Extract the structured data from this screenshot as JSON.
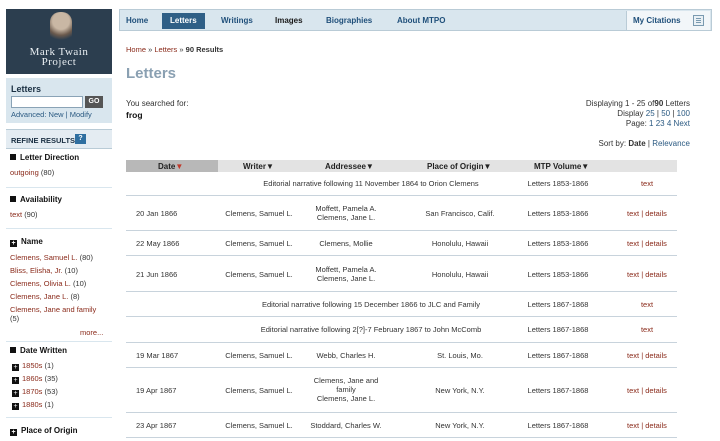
{
  "nav": {
    "items": [
      "Home",
      "Letters",
      "Writings",
      "Images",
      "Biographies",
      "About MTPO"
    ],
    "active": "Letters",
    "citations": "My Citations"
  },
  "logo": {
    "line1": "Mark Twain",
    "line2": "Project"
  },
  "search": {
    "label": "Letters",
    "value": "",
    "go": "GO",
    "advanced": "Advanced:",
    "new": "New",
    "sep": "|",
    "modify": "Modify"
  },
  "refine": {
    "label": "REFINE RESULTS",
    "help": "?"
  },
  "facets": {
    "direction": {
      "title": "Letter Direction",
      "items": [
        {
          "label": "outgoing",
          "count": "(80)"
        }
      ]
    },
    "availability": {
      "title": "Availability",
      "items": [
        {
          "label": "text",
          "count": "(90)"
        }
      ]
    },
    "name": {
      "title": "Name",
      "items": [
        {
          "label": "Clemens, Samuel L.",
          "count": "(80)"
        },
        {
          "label": "Bliss, Elisha, Jr.",
          "count": "(10)"
        },
        {
          "label": "Clemens, Olivia L.",
          "count": "(10)"
        },
        {
          "label": "Clemens, Jane L.",
          "count": "(8)"
        },
        {
          "label": "Clemens, Jane and family",
          "count": "(5)"
        }
      ],
      "more": "more..."
    },
    "date": {
      "title": "Date Written",
      "items": [
        {
          "label": "1850s",
          "count": "(1)"
        },
        {
          "label": "1860s",
          "count": "(35)"
        },
        {
          "label": "1870s",
          "count": "(53)"
        },
        {
          "label": "1880s",
          "count": "(1)"
        }
      ]
    },
    "origin": {
      "title": "Place of Origin"
    }
  },
  "breadcrumb": {
    "home": "Home",
    "letters": "Letters",
    "sep": "»",
    "results": "90 Results"
  },
  "title": "Letters",
  "searched": {
    "label": "You searched for:",
    "term": "frog"
  },
  "results": {
    "displaying": "Displaying 1 - 25 of",
    "total": "90",
    "unit": "Letters",
    "display_label": "Display",
    "sizes": [
      "25",
      "50",
      "100"
    ],
    "page_label": "Page:",
    "pages": [
      "1",
      "2",
      "3",
      "4"
    ],
    "next": "Next",
    "sort_label": "Sort by:",
    "sort_date": "Date",
    "sort_relevance": "Relevance"
  },
  "table": {
    "headers": [
      "Date",
      "Writer",
      "Addressee",
      "Place of Origin",
      "MTP Volume"
    ],
    "rows": [
      {
        "narrative": "Editorial narrative following 11 November 1864 to Orion Clemens",
        "volume": "Letters 1853-1866",
        "actions": "text"
      },
      {
        "date": "20 Jan 1866",
        "writer": "Clemens, Samuel L.",
        "addressee": "Moffett, Pamela A.\nClemens, Jane L.",
        "place": "San Francisco, Calif.",
        "volume": "Letters 1853-1866",
        "actions": "text | details"
      },
      {
        "date": "22 May 1866",
        "writer": "Clemens, Samuel L.",
        "addressee": "Clemens, Mollie",
        "place": "Honolulu, Hawaii",
        "volume": "Letters 1853-1866",
        "actions": "text | details"
      },
      {
        "date": "21 Jun 1866",
        "writer": "Clemens, Samuel L.",
        "addressee": "Moffett, Pamela A.\nClemens, Jane L.",
        "place": "Honolulu, Hawaii",
        "volume": "Letters 1853-1866",
        "actions": "text | details"
      },
      {
        "narrative": "Editorial narrative following 15 December 1866 to JLC and Family",
        "volume": "Letters 1867-1868",
        "actions": "text"
      },
      {
        "narrative": "Editorial narrative following 2[?]-7 February 1867 to John McComb",
        "volume": "Letters 1867-1868",
        "actions": "text"
      },
      {
        "date": "19 Mar 1867",
        "writer": "Clemens, Samuel L.",
        "addressee": "Webb, Charles H.",
        "place": "St. Louis, Mo.",
        "volume": "Letters 1867-1868",
        "actions": "text | details"
      },
      {
        "date": "19 Apr 1867",
        "writer": "Clemens, Samuel L.",
        "addressee": "Clemens, Jane and\nfamily\nClemens, Jane L.",
        "place": "New York, N.Y.",
        "volume": "Letters 1867-1868",
        "actions": "text | details"
      },
      {
        "date": "23 Apr 1867",
        "writer": "Clemens, Samuel L.",
        "addressee": "Stoddard, Charles W.",
        "place": "New York, N.Y.",
        "volume": "Letters 1867-1868",
        "actions": "text | details"
      }
    ]
  },
  "colors": {
    "nav_bg": "#d9e6ee",
    "active_tab": "#2f5f86",
    "link": "#8a2a1a",
    "title": "#8aa0b2",
    "sidebar_dark": "#2c3e4f"
  }
}
